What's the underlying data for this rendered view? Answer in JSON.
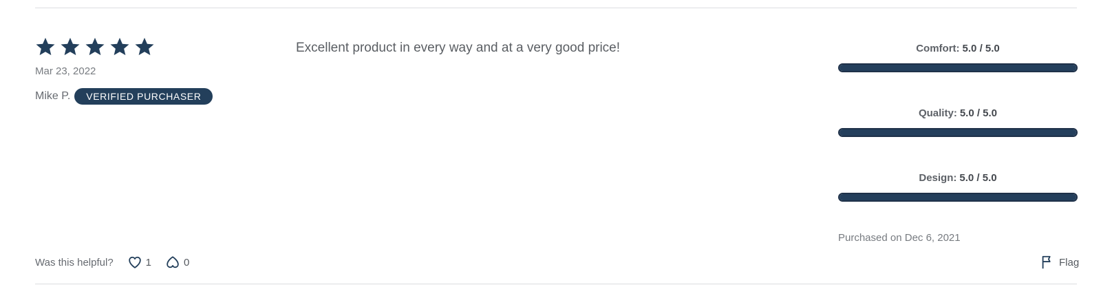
{
  "review": {
    "rating": 5,
    "rating_max": 5,
    "date": "Mar 23, 2022",
    "reviewer_name": "Mike P.",
    "badge_label": "VERIFIED PURCHASER",
    "text": "Excellent product in every way and at a very good price!",
    "purchased_label": "Purchased on Dec 6, 2021"
  },
  "ratings": [
    {
      "label": "Comfort:",
      "score": "5.0 / 5.0",
      "fraction": 1.0
    },
    {
      "label": "Quality:",
      "score": "5.0 / 5.0",
      "fraction": 1.0
    },
    {
      "label": "Design:",
      "score": "5.0 / 5.0",
      "fraction": 1.0
    }
  ],
  "helpful": {
    "question": "Was this helpful?",
    "upvotes": "1",
    "downvotes": "0"
  },
  "flag_label": "Flag",
  "colors": {
    "primary": "#233f5b",
    "text": "#555a60",
    "muted": "#777b80",
    "divider": "#dcdde0"
  }
}
